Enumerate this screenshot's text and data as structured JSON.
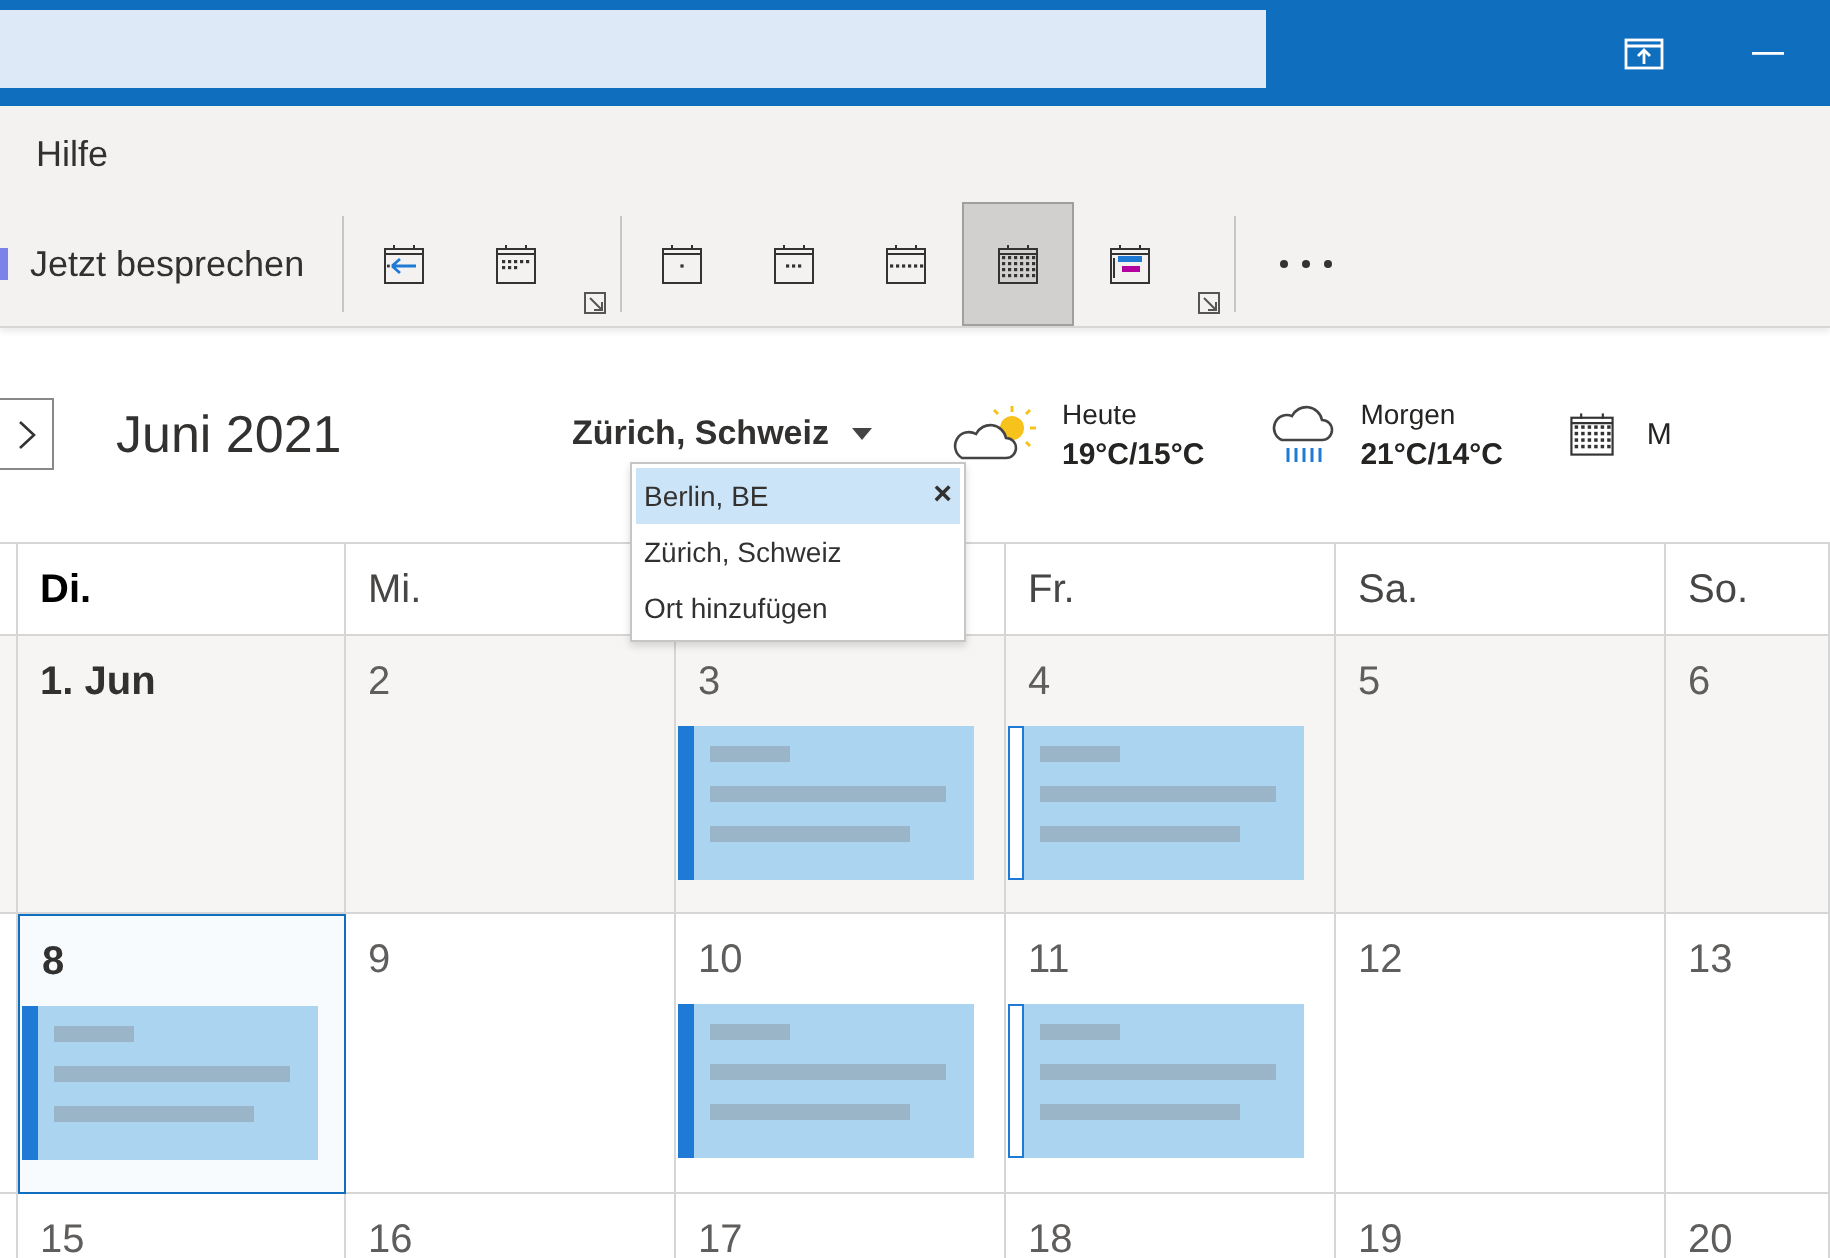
{
  "ribbon": {
    "menu": [
      {
        "label": "Hilfe"
      }
    ],
    "meet_now": {
      "label": "Jetzt besprechen"
    },
    "tools": [
      {
        "kind": "today",
        "selected": false
      },
      {
        "kind": "next7",
        "selected": false
      },
      {
        "kind": "launcher"
      },
      {
        "kind": "sep"
      },
      {
        "kind": "day",
        "selected": false
      },
      {
        "kind": "workweek",
        "selected": false
      },
      {
        "kind": "week",
        "selected": false
      },
      {
        "kind": "month",
        "selected": true
      },
      {
        "kind": "schedule",
        "selected": false
      },
      {
        "kind": "launcher"
      },
      {
        "kind": "sep"
      },
      {
        "kind": "more"
      }
    ]
  },
  "header": {
    "month": "Juni 2021",
    "location": "Zürich, Schweiz",
    "weather": [
      {
        "kind": "sun-cloud",
        "label": "Heute",
        "temps": "19°C/15°C"
      },
      {
        "kind": "rain",
        "label": "Morgen",
        "temps": "21°C/14°C"
      }
    ],
    "next_label": "M",
    "locations": [
      {
        "label": "Berlin, BE",
        "selected": true,
        "remove": "×"
      },
      {
        "label": "Zürich, Schweiz",
        "selected": false
      },
      {
        "label": "Ort hinzufügen",
        "selected": false
      }
    ]
  },
  "grid": {
    "weekdays": [
      {
        "label": "Di.",
        "selected": true
      },
      {
        "label": "Mi.",
        "selected": false
      },
      {
        "kind": "covered"
      },
      {
        "label": "Fr.",
        "selected": false
      },
      {
        "label": "Sa.",
        "selected": false
      },
      {
        "label": "So.",
        "selected": false
      }
    ],
    "weeks": [
      {
        "past": true,
        "days": [
          {
            "label": "1. Jun",
            "month_start": true,
            "today": false
          },
          {
            "label": "2",
            "month_start": false,
            "today": false
          },
          {
            "label": "3",
            "month_start": false,
            "today": false,
            "events": [
              {
                "kind": "busy"
              }
            ]
          },
          {
            "label": "4",
            "month_start": false,
            "today": false,
            "events": [
              {
                "kind": "tentative"
              }
            ]
          },
          {
            "label": "5",
            "month_start": false,
            "today": false
          },
          {
            "label": "6",
            "month_start": false,
            "today": false
          }
        ]
      },
      {
        "past": false,
        "days": [
          {
            "label": "8",
            "month_start": false,
            "today": true,
            "events": [
              {
                "kind": "busy"
              }
            ]
          },
          {
            "label": "9",
            "month_start": false,
            "today": false
          },
          {
            "label": "10",
            "month_start": false,
            "today": false,
            "events": [
              {
                "kind": "busy"
              }
            ]
          },
          {
            "label": "11",
            "month_start": false,
            "today": false,
            "events": [
              {
                "kind": "tentative"
              }
            ]
          },
          {
            "label": "12",
            "month_start": false,
            "today": false
          },
          {
            "label": "13",
            "month_start": false,
            "today": false
          }
        ]
      },
      {
        "past": false,
        "days": [
          {
            "label": "15",
            "month_start": false,
            "today": false
          },
          {
            "label": "16",
            "month_start": false,
            "today": false
          },
          {
            "label": "17",
            "month_start": false,
            "today": false
          },
          {
            "label": "18",
            "month_start": false,
            "today": false
          },
          {
            "label": "19",
            "month_start": false,
            "today": false
          },
          {
            "label": "20",
            "month_start": false,
            "today": false
          }
        ]
      }
    ]
  }
}
